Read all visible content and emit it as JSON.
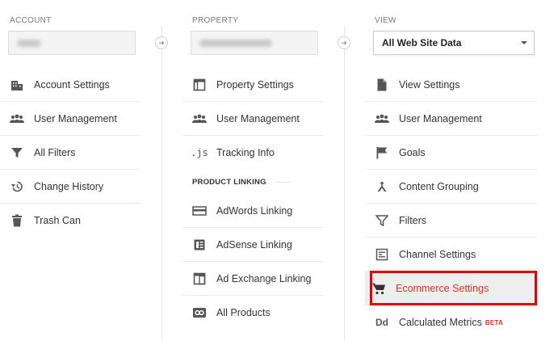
{
  "columns": {
    "account": {
      "header": "ACCOUNT",
      "items": [
        {
          "label": "Account Settings",
          "icon": "building-icon"
        },
        {
          "label": "User Management",
          "icon": "people-icon"
        },
        {
          "label": "All Filters",
          "icon": "filter-icon"
        },
        {
          "label": "Change History",
          "icon": "history-icon"
        },
        {
          "label": "Trash Can",
          "icon": "trash-icon"
        }
      ]
    },
    "property": {
      "header": "PROPERTY",
      "items": [
        {
          "label": "Property Settings",
          "icon": "property-settings-icon"
        },
        {
          "label": "User Management",
          "icon": "people-icon"
        },
        {
          "label": "Tracking Info",
          "icon": "js-icon",
          "glyph": ".js"
        }
      ],
      "section_label": "PRODUCT LINKING",
      "linking_items": [
        {
          "label": "AdWords Linking",
          "icon": "adwords-icon"
        },
        {
          "label": "AdSense Linking",
          "icon": "adsense-icon"
        },
        {
          "label": "Ad Exchange Linking",
          "icon": "ad-exchange-icon"
        },
        {
          "label": "All Products",
          "icon": "link-icon"
        }
      ]
    },
    "view": {
      "header": "VIEW",
      "selected": "All Web Site Data",
      "items": [
        {
          "label": "View Settings",
          "icon": "document-icon"
        },
        {
          "label": "User Management",
          "icon": "people-icon"
        },
        {
          "label": "Goals",
          "icon": "flag-icon"
        },
        {
          "label": "Content Grouping",
          "icon": "content-grouping-icon"
        },
        {
          "label": "Filters",
          "icon": "filter-icon"
        },
        {
          "label": "Channel Settings",
          "icon": "channel-settings-icon"
        },
        {
          "label": "Ecommerce Settings",
          "icon": "cart-icon"
        },
        {
          "label": "Calculated Metrics",
          "icon": "dd-icon",
          "glyph": "Dd",
          "badge": "BETA"
        }
      ]
    }
  },
  "colors": {
    "highlight": "#e30000",
    "active_text": "#d9341e",
    "icon": "#555555"
  }
}
